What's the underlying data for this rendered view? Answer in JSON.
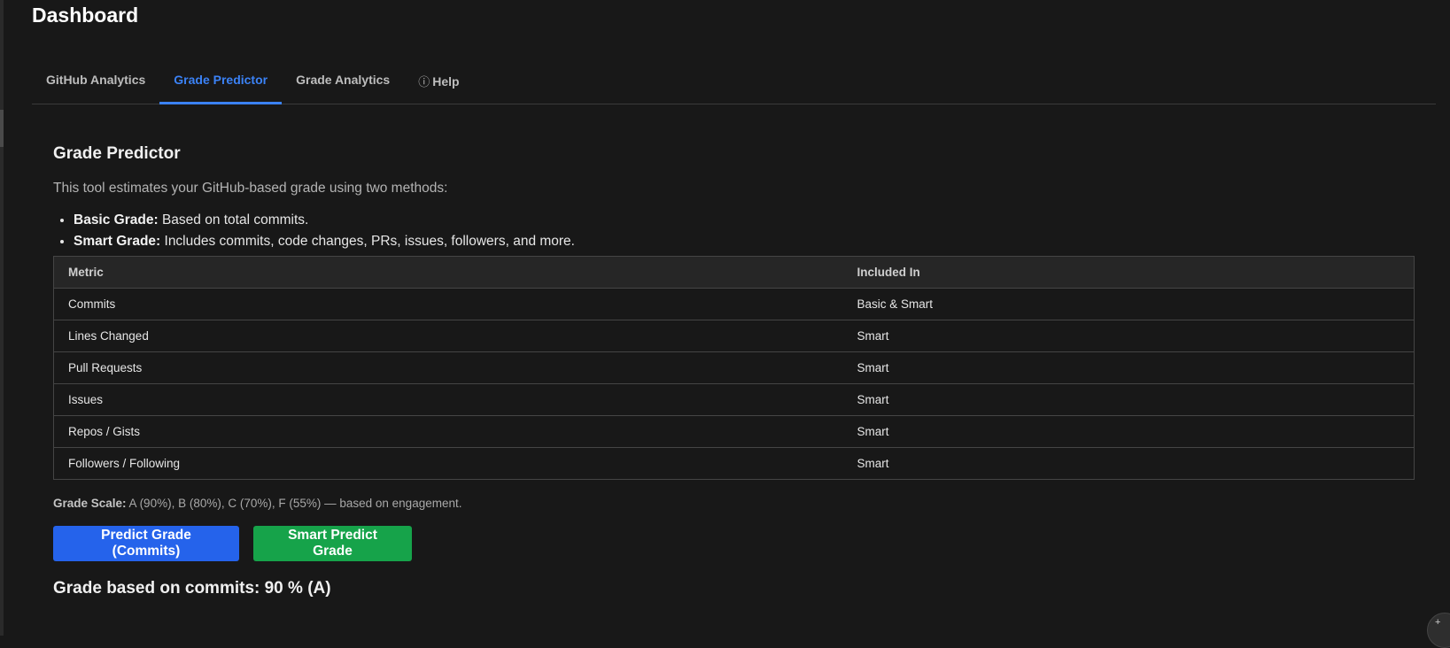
{
  "header": {
    "title": "Dashboard"
  },
  "tabs": [
    {
      "label": "GitHub Analytics",
      "active": false
    },
    {
      "label": "Grade Predictor",
      "active": true
    },
    {
      "label": "Grade Analytics",
      "active": false
    },
    {
      "label": "Help",
      "icon": "info-icon",
      "active": false
    }
  ],
  "predictor": {
    "title": "Grade Predictor",
    "intro": "This tool estimates your GitHub-based grade using two methods:",
    "methods": [
      {
        "name": "Basic Grade:",
        "desc": " Based on total commits."
      },
      {
        "name": "Smart Grade:",
        "desc": " Includes commits, code changes, PRs, issues, followers, and more."
      }
    ],
    "table": {
      "headers": [
        "Metric",
        "Included In"
      ],
      "rows": [
        [
          "Commits",
          "Basic & Smart"
        ],
        [
          "Lines Changed",
          "Smart"
        ],
        [
          "Pull Requests",
          "Smart"
        ],
        [
          "Issues",
          "Smart"
        ],
        [
          "Repos / Gists",
          "Smart"
        ],
        [
          "Followers / Following",
          "Smart"
        ]
      ]
    },
    "grade_scale_label": "Grade Scale:",
    "grade_scale_text": " A (90%), B (80%), C (70%), F (55%) — based on engagement.",
    "buttons": {
      "predict": "Predict Grade (Commits)",
      "smart": "Smart Predict Grade"
    },
    "result": "Grade based on commits: 90 % (A)"
  },
  "colors": {
    "background": "#181818",
    "accent": "#3b82f6",
    "primary_button": "#2563eb",
    "success_button": "#16a34a"
  }
}
